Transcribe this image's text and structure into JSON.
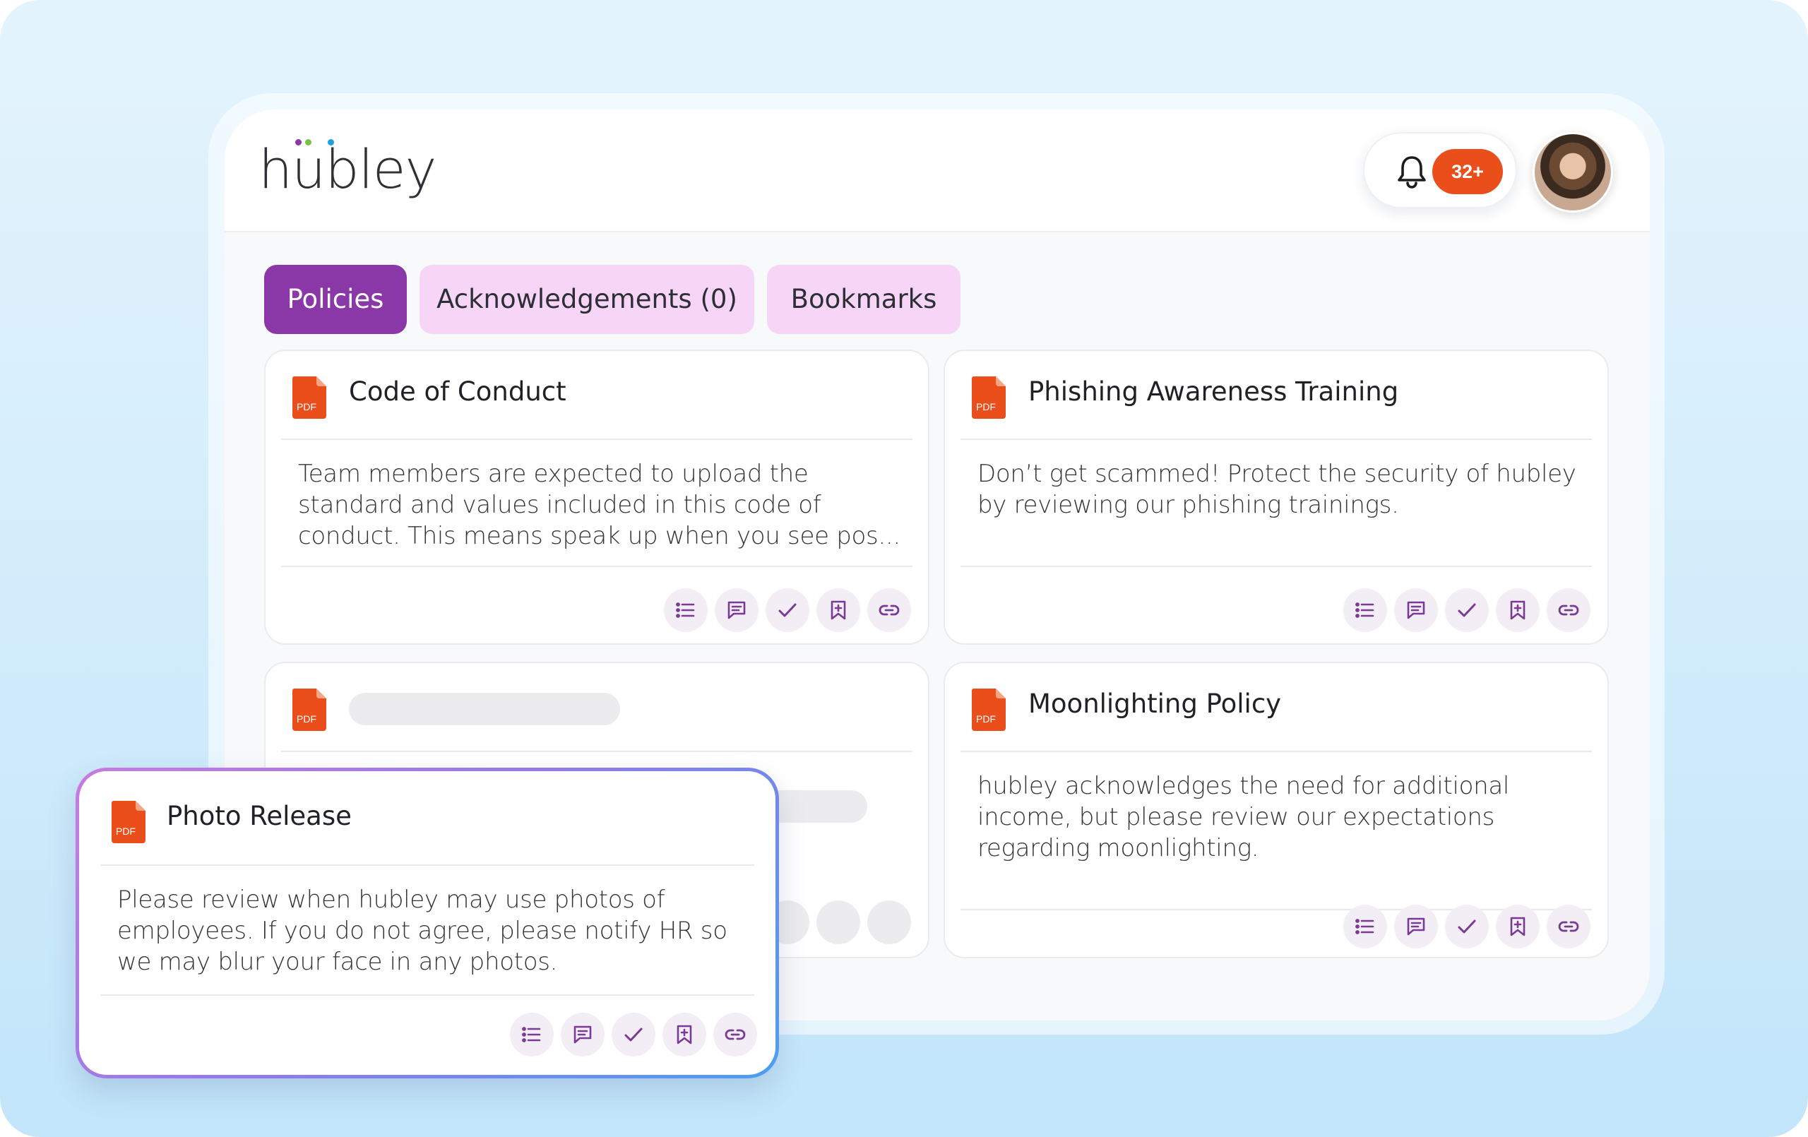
{
  "app": {
    "logo_text": "hubley",
    "notification_count": "32+",
    "colors": {
      "accent": "#8a37a8",
      "tab_inactive": "#f7d5f7",
      "badge": "#e94e1b",
      "pdf_icon": "#e94e1b"
    }
  },
  "tabs": [
    {
      "label": "Policies",
      "active": true
    },
    {
      "label": "Acknowledgements (0)",
      "active": false
    },
    {
      "label": "Bookmarks",
      "active": false
    }
  ],
  "cards": [
    {
      "title": "Code of Conduct",
      "body": "Team members are expected to upload the standard and values included in this code of conduct. This means speak up when you see pos...",
      "file_type": "PDF"
    },
    {
      "title": "Phishing Awareness Training",
      "body": "Don’t get scammed! Protect the security of hubley by reviewing our phishing trainings.",
      "file_type": "PDF"
    },
    {
      "title": "",
      "body": "",
      "file_type": "PDF",
      "loading": true
    },
    {
      "title": "Moonlighting Policy",
      "body": "hubley acknowledges the need for additional income, but please review our expectations regarding moonlighting.",
      "file_type": "PDF"
    }
  ],
  "floating_card": {
    "title": "Photo Release",
    "body": "Please review when hubley may use photos of employees. If you do not agree, please notify HR so we may blur your face in any photos.",
    "file_type": "PDF"
  },
  "card_actions": [
    "list-icon",
    "comment-icon",
    "check-icon",
    "bookmark-add-icon",
    "link-icon"
  ]
}
